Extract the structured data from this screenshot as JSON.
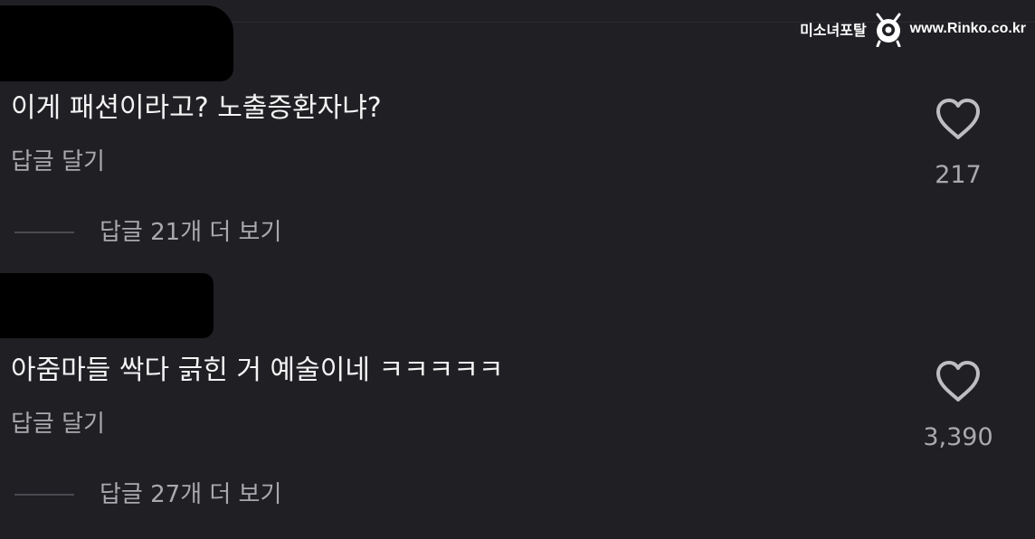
{
  "watermark": {
    "site_name": "미소녀포탈",
    "url": "www.Rinko.co.kr"
  },
  "comments": [
    {
      "text": "이게 패션이라고? 노출증환자냐?",
      "reply_label": "답글 달기",
      "view_replies_label": "답글 21개 더 보기",
      "likes": "217"
    },
    {
      "text": "아줌마들 싹다 긁힌 거 예술이네 ㅋㅋㅋㅋㅋ",
      "reply_label": "답글 달기",
      "view_replies_label": "답글 27개 더 보기",
      "likes": "3,390"
    }
  ],
  "icons": {
    "like": "heart-outline-icon",
    "logo": "mascot-logo-icon"
  },
  "colors": {
    "background": "#1f1f24",
    "primary_text": "#f4f4f4",
    "secondary_text": "#a9a9ae",
    "redaction": "#000000"
  }
}
